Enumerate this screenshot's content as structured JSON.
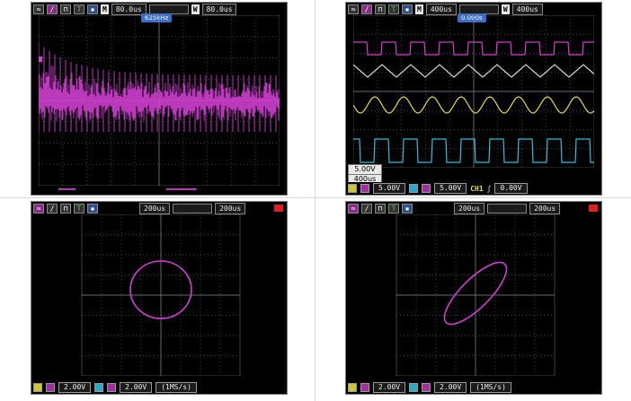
{
  "panels": {
    "fft": {
      "mode": "M",
      "timebase_left": "80.0us",
      "timebase_right": "80.0us",
      "window": "W",
      "trigger_flag": "625kHz"
    },
    "waves": {
      "mode": "M",
      "timebase_left": "400us",
      "timebase_right": "400us",
      "window": "W",
      "trigger_flag": "0.000s",
      "info_volt": "5.00V",
      "info_time": "400us",
      "ch_volt_a": "5.00V",
      "ch_volt_b": "5.00V",
      "trig_channel": "CH1",
      "trig_level": "0.00V"
    },
    "xy_circle": {
      "timebase_left": "200us",
      "timebase_right": "200us",
      "ch_volt_a": "2.00V",
      "ch_volt_b": "2.00V",
      "rate": "(1MS/s)"
    },
    "xy_ellipse": {
      "timebase_left": "200us",
      "timebase_right": "200us",
      "ch_volt_a": "2.00V",
      "ch_volt_b": "2.00V",
      "rate": "(1MS/s)"
    }
  },
  "colors": {
    "magenta": "#d040d0",
    "white": "#d8d8d8",
    "yellow": "#e6dd3a",
    "cyan": "#30c0d8",
    "grid": "#5a5a5a"
  },
  "icons": [
    "waveform-icon",
    "probe-icon",
    "pulse-icon",
    "trigger-icon",
    "save-icon"
  ]
}
